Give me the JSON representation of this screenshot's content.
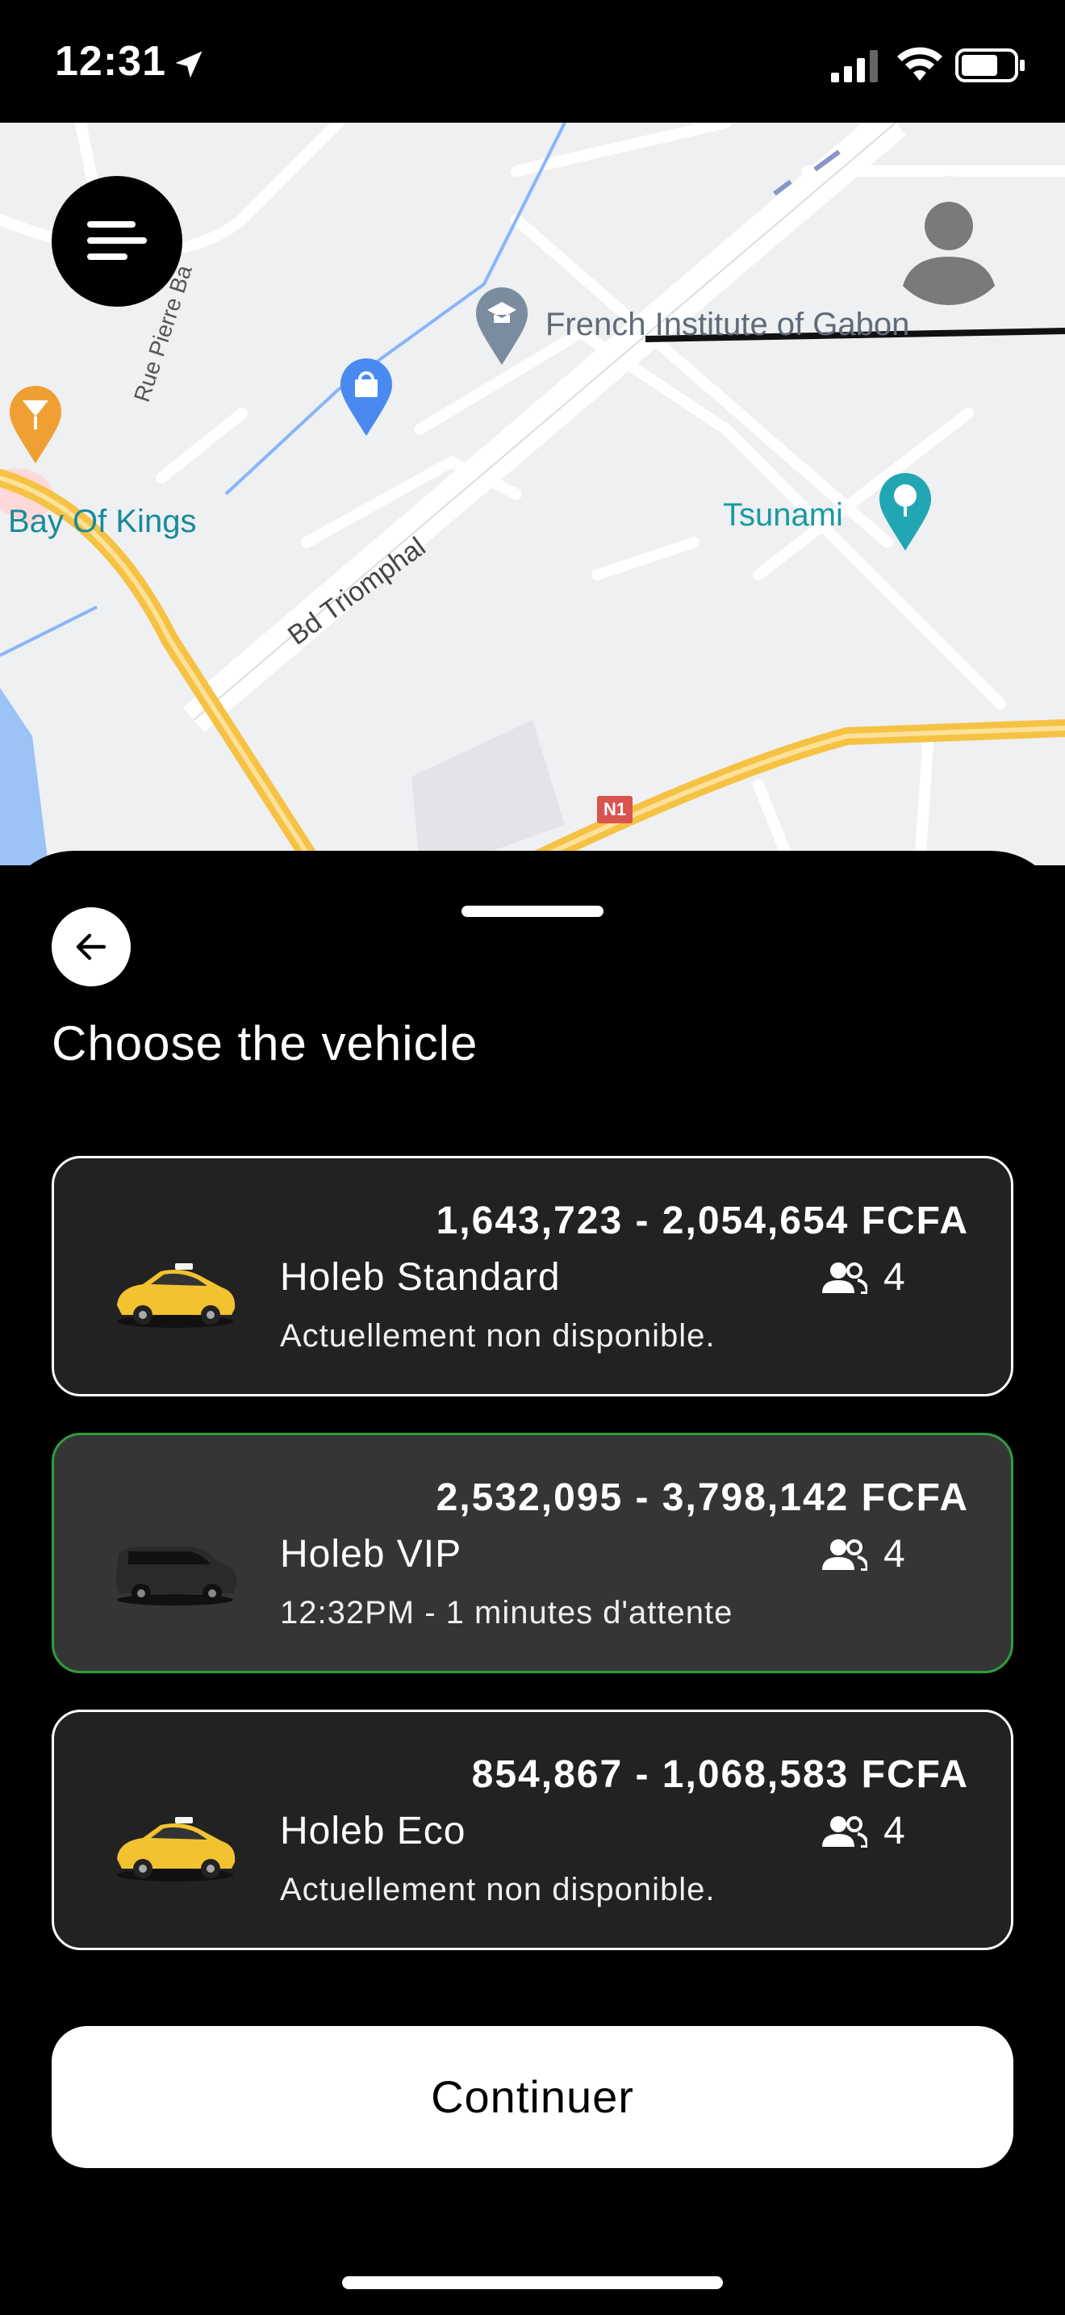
{
  "status_bar": {
    "time": "12:31",
    "icons": [
      "location-arrow-icon",
      "signal-icon",
      "wifi-icon",
      "battery-icon"
    ]
  },
  "map": {
    "labels": {
      "french_institute": "French Institute of Gabon",
      "bay_of_kings": "Bay Of Kings",
      "tsunami": "Tsunami",
      "rue_pierre": "Rue Pierre Ba",
      "bd_triomphal": "Bd Triomphal",
      "n1": "N1"
    },
    "colors": {
      "road": "#f6c244",
      "water": "#9cc3f5",
      "background": "#eef0f2"
    }
  },
  "sheet": {
    "title": "Choose the vehicle",
    "vehicles": [
      {
        "price": "1,643,723 - 2,054,654 FCFA",
        "name": "Holeb Standard",
        "seats": "4",
        "subtitle": "Actuellement non disponible.",
        "icon": "yellow-taxi",
        "selected": false
      },
      {
        "price": "2,532,095 - 3,798,142 FCFA",
        "name": "Holeb VIP",
        "seats": "4",
        "subtitle": "12:32PM - 1 minutes d'attente",
        "icon": "black-suv",
        "selected": true
      },
      {
        "price": "854,867 - 1,068,583 FCFA",
        "name": "Holeb Eco",
        "seats": "4",
        "subtitle": "Actuellement non disponible.",
        "icon": "yellow-taxi",
        "selected": false
      }
    ],
    "continue_label": "Continuer"
  },
  "colors": {
    "selected_border": "#2e9e3e",
    "card_bg": "#222222",
    "selected_bg": "#353535"
  }
}
